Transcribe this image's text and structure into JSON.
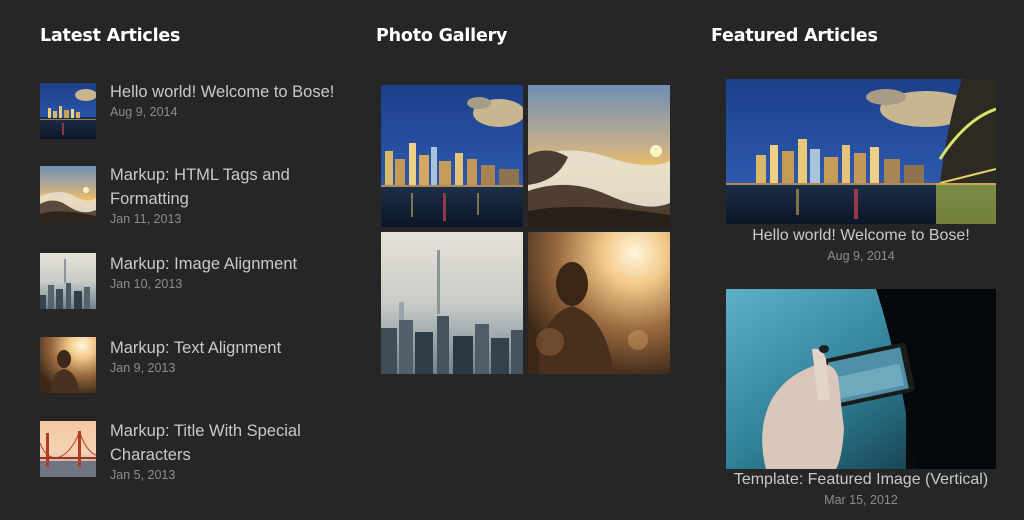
{
  "latest": {
    "title": "Latest Articles",
    "items": [
      {
        "title": "Hello world! Welcome to Bose!",
        "date": "Aug 9, 2014",
        "image": "sydney-harbour-night-thumbnail"
      },
      {
        "title": "Markup: HTML Tags and Formatting",
        "date": "Jan 11, 2013",
        "image": "sunrise-over-fog-thumbnail"
      },
      {
        "title": "Markup: Image Alignment",
        "date": "Jan 10, 2013",
        "image": "hazy-city-skyline-thumbnail"
      },
      {
        "title": "Markup: Text Alignment",
        "date": "Jan 9, 2013",
        "image": "person-in-sunlight-thumbnail"
      },
      {
        "title": "Markup: Title With Special Characters",
        "date": "Jan 5, 2013",
        "image": "golden-gate-bridge-thumbnail"
      }
    ]
  },
  "gallery": {
    "title": "Photo Gallery",
    "images": [
      "sydney-harbour-night",
      "sunrise-over-fog",
      "hazy-city-skyline",
      "person-in-sunlight"
    ]
  },
  "featured": {
    "title": "Featured Articles",
    "items": [
      {
        "title": "Hello world! Welcome to Bose!",
        "date": "Aug 9, 2014",
        "image": "sydney-harbour-bridge-night"
      },
      {
        "title": "Template: Featured Image (Vertical)",
        "date": "Mar 15, 2012",
        "image": "hand-holding-phone"
      }
    ]
  }
}
